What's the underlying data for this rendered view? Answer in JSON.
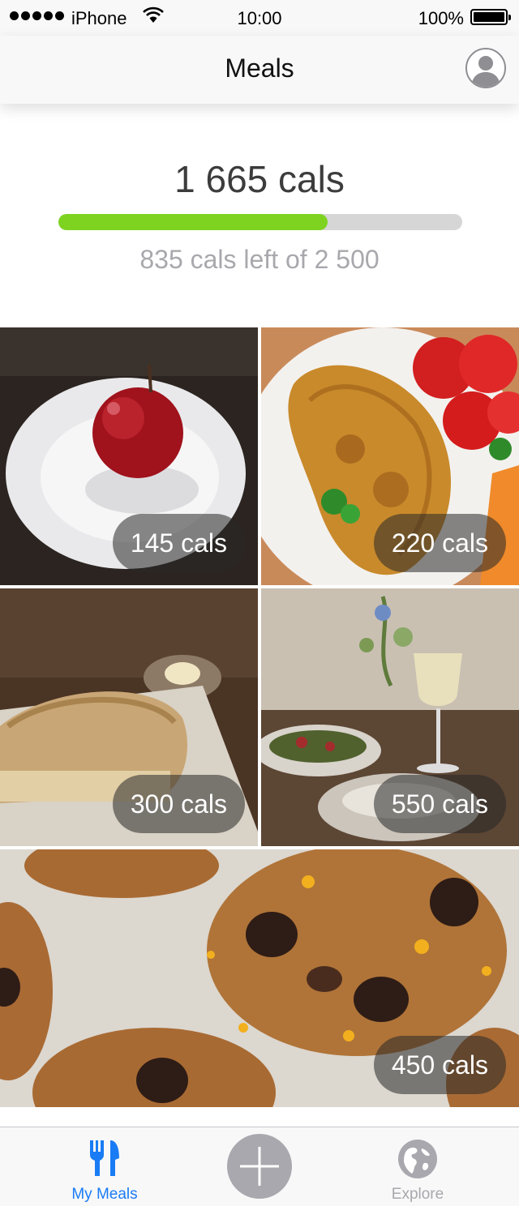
{
  "status_bar": {
    "carrier": "iPhone",
    "time": "10:00",
    "battery": "100%"
  },
  "nav": {
    "title": "Meals",
    "profile_icon": "user-avatar-icon"
  },
  "summary": {
    "consumed": "1 665 cals",
    "remaining": "835 cals left of 2 500",
    "progress_fraction": 0.666,
    "progress_color": "#7ed321"
  },
  "meals": [
    {
      "label": "145 cals",
      "photo": "apple on white plate"
    },
    {
      "label": "220 cals",
      "photo": "omelette with tomatoes"
    },
    {
      "label": "300 cals",
      "photo": "loaf of bread"
    },
    {
      "label": "550 cals",
      "photo": "salad and wine"
    },
    {
      "label": "450 cals",
      "photo": "chocolate chip cookies"
    }
  ],
  "tab_bar": {
    "my_meals": "My Meals",
    "explore": "Explore",
    "active_color": "#1a7cf5",
    "inactive_color": "#a8a8ae"
  }
}
